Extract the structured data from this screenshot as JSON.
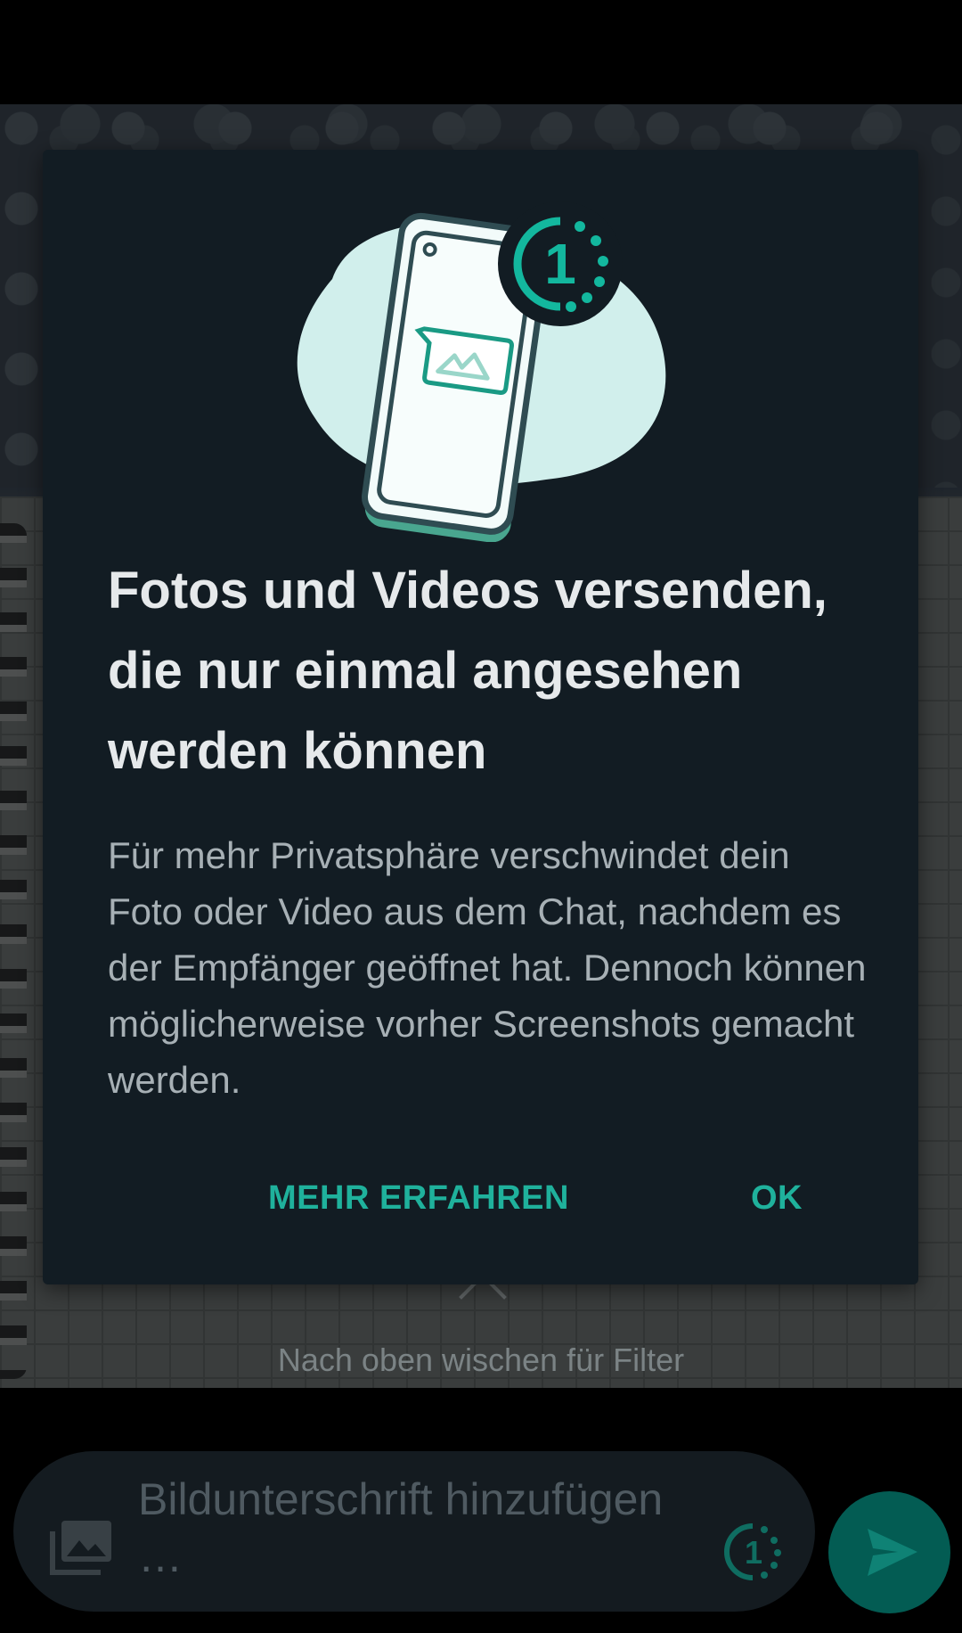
{
  "dialog": {
    "title": "Fotos und Videos versenden, die nur einmal angesehen werden können",
    "body": "Für mehr Privatsphäre verschwindet dein Foto oder Video aus dem Chat, nachdem es der Empfänger geöffnet hat. Dennoch können möglicherweise vorher Screenshots gemacht werden.",
    "illustration_badge": "1",
    "actions": {
      "learn_more": "MEHR ERFAHREN",
      "ok": "OK"
    }
  },
  "swipe_hint": "Nach oben wischen für Filter",
  "compose": {
    "placeholder": "Bildunterschrift hinzufügen …",
    "view_once_badge": "1"
  },
  "colors": {
    "accent": "#1fb19c",
    "dialog_background": "#121c23",
    "send_button": "#035c53"
  },
  "icons": {
    "gallery": "gallery-icon",
    "view_once": "view-once-icon",
    "send": "send-icon",
    "swipe_up": "chevron-up-icon"
  }
}
